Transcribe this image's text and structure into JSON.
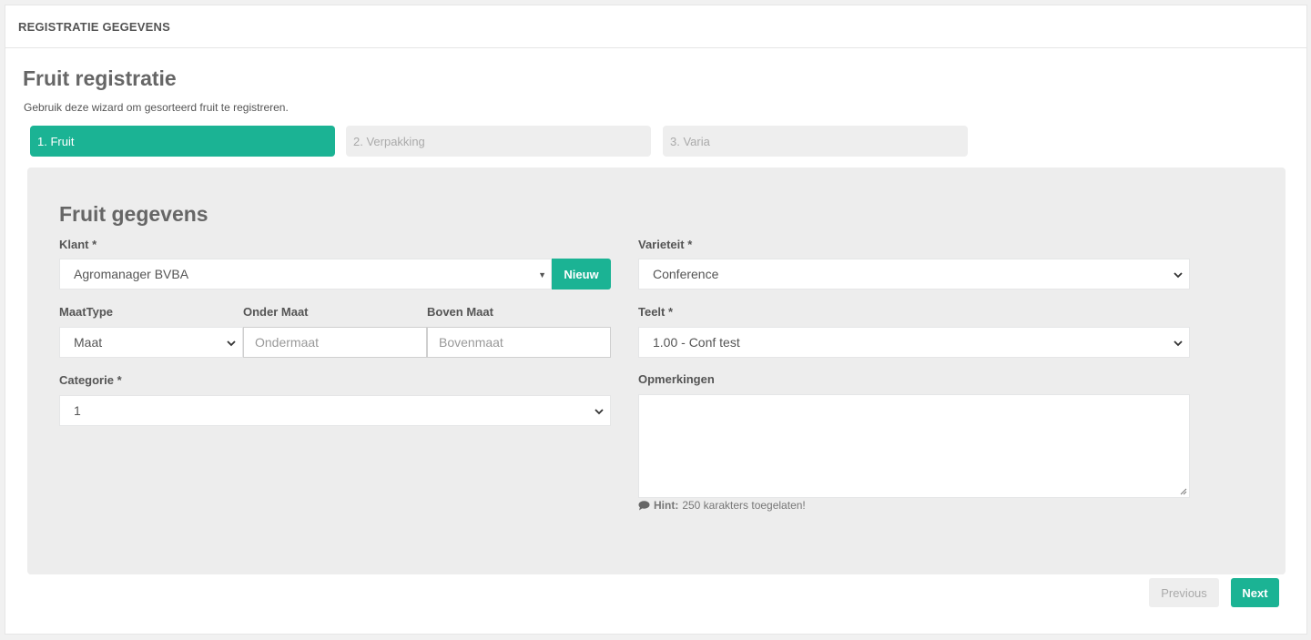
{
  "panel": {
    "title": "REGISTRATIE GEGEVENS"
  },
  "page": {
    "title": "Fruit registratie",
    "description": "Gebruik deze wizard om gesorteerd fruit te registreren."
  },
  "steps": [
    {
      "label": "1. Fruit",
      "active": true
    },
    {
      "label": "2. Verpakking",
      "active": false
    },
    {
      "label": "3. Varia",
      "active": false
    }
  ],
  "form": {
    "section_title": "Fruit gegevens",
    "klant": {
      "label": "Klant *",
      "value": "Agromanager BVBA",
      "new_button": "Nieuw"
    },
    "maattype": {
      "label": "MaatType",
      "value": "Maat"
    },
    "onder_maat": {
      "label": "Onder Maat",
      "placeholder": "Ondermaat"
    },
    "boven_maat": {
      "label": "Boven Maat",
      "placeholder": "Bovenmaat"
    },
    "categorie": {
      "label": "Categorie *",
      "value": "1"
    },
    "varieteit": {
      "label": "Varieteit *",
      "value": "Conference"
    },
    "teelt": {
      "label": "Teelt *",
      "value": "1.00 - Conf test"
    },
    "opmerkingen": {
      "label": "Opmerkingen",
      "value": ""
    },
    "hint": {
      "prefix": "Hint:",
      "text": "250 karakters toegelaten!",
      "icon": "comment-icon"
    }
  },
  "buttons": {
    "previous": "Previous",
    "next": "Next"
  },
  "colors": {
    "accent": "#1bb394",
    "panel_bg": "#ededed",
    "step_inactive": "#eeeeee"
  }
}
